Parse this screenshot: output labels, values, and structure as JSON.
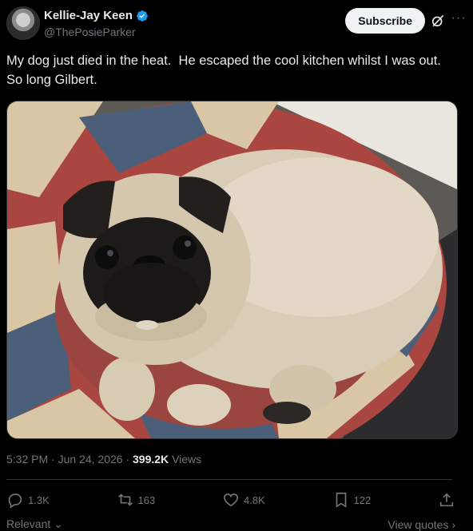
{
  "author": {
    "name": "Kellie-Jay Keen",
    "handle": "@ThePosieParker",
    "verified": true
  },
  "header": {
    "subscribe_label": "Subscribe"
  },
  "tweet": {
    "text": "My dog just died in the heat.  He escaped the cool kitchen whilst I was out.  So long Gilbert."
  },
  "media": {
    "subject": "pug lying on union-jack dog bed",
    "colors": {
      "fur": "#d9cdb8",
      "mask": "#1c1b1a",
      "bed_red": "#a8463f",
      "bed_blue": "#4c5f7a",
      "bed_cream": "#d8c6a4"
    }
  },
  "meta": {
    "time": "5:32 PM",
    "separator": "·",
    "date": "Jun 24, 2026",
    "views_count": "399.2K",
    "views_label": "Views"
  },
  "actions": {
    "replies": "1.3K",
    "reposts": "163",
    "likes": "4.8K",
    "bookmarks": "122"
  },
  "footer": {
    "relevant_label": "Relevant",
    "view_quotes_label": "View quotes"
  },
  "colors": {
    "background": "#000000",
    "text": "#e7e9ea",
    "muted": "#71767b",
    "verified": "#1d9bf0",
    "subscribe_bg": "#eff3f4"
  }
}
